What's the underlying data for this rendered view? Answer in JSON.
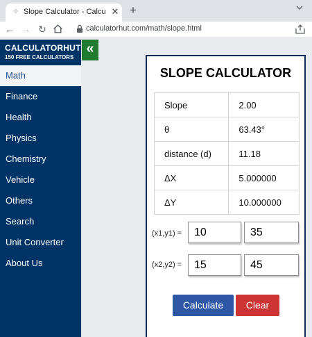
{
  "browser": {
    "tab_title": "Slope Calculator - Calculate Slope",
    "url": "calculatorhut.com/math/slope.html"
  },
  "brand": {
    "name": "CALCULATORHUT",
    "subtitle": "150 FREE CALCULATORS",
    "collapse_symbol": "«"
  },
  "sidebar": {
    "active": "Math",
    "items": [
      "Finance",
      "Health",
      "Physics",
      "Chemistry",
      "Vehicle",
      "Others",
      "Search",
      "Unit Converter",
      "About Us"
    ]
  },
  "calculator": {
    "title": "SLOPE CALCULATOR",
    "results": [
      {
        "label": "Slope",
        "value": "2.00"
      },
      {
        "label": "θ",
        "value": "63.43°"
      },
      {
        "label": "distance (d)",
        "value": "11.18"
      },
      {
        "label": "ΔX",
        "value": "5.000000"
      },
      {
        "label": "ΔY",
        "value": "10.000000"
      }
    ],
    "point1": {
      "label": "(x1,y1) =",
      "x": "10",
      "y": "35"
    },
    "point2": {
      "label": "(x2,y2) =",
      "x": "15",
      "y": "45"
    },
    "calculate_label": "Calculate",
    "clear_label": "Clear"
  },
  "colors": {
    "sidebar": "#003366",
    "collapse_button": "#1e7b2f",
    "calculate_button": "#2e58a6",
    "clear_button": "#cd3535"
  },
  "icons": [
    "favicon-icon",
    "close-icon",
    "plus-icon",
    "chevron-down-icon",
    "back-arrow-icon",
    "forward-arrow-icon",
    "reload-icon",
    "home-icon",
    "lock-icon",
    "share-icon",
    "double-chevron-left-icon"
  ]
}
